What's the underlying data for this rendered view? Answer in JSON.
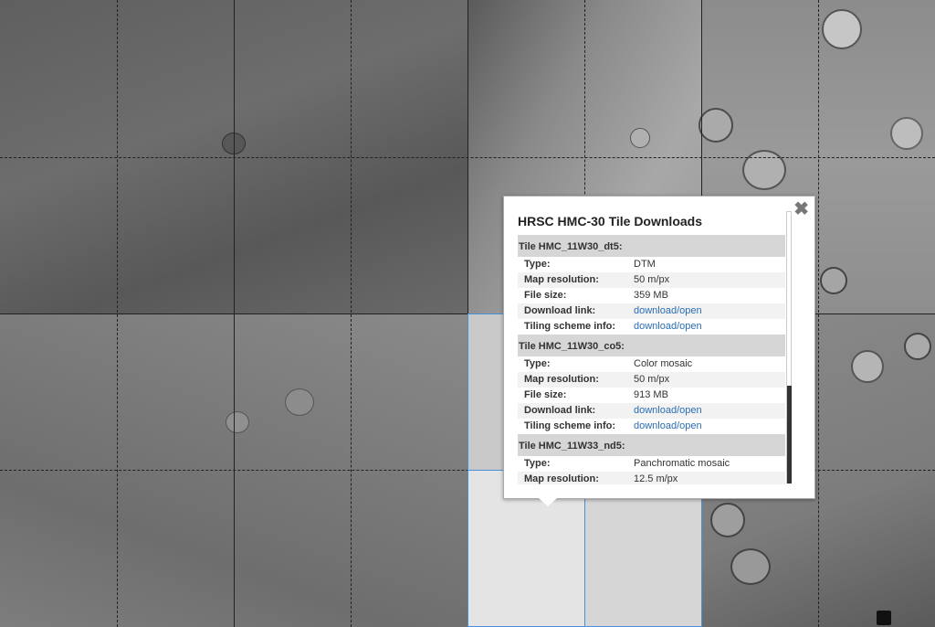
{
  "popup": {
    "title": "HRSC HMC-30 Tile Downloads",
    "close_icon": "close-icon",
    "tiles": [
      {
        "heading": "Tile HMC_11W30_dt5:",
        "rows": [
          {
            "label": "Type:",
            "value": "DTM",
            "link": false
          },
          {
            "label": "Map resolution:",
            "value": "50 m/px",
            "link": false
          },
          {
            "label": "File size:",
            "value": "359 MB",
            "link": false
          },
          {
            "label": "Download link:",
            "value": "download/open",
            "link": true
          },
          {
            "label": "Tiling scheme info:",
            "value": "download/open",
            "link": true
          }
        ]
      },
      {
        "heading": "Tile HMC_11W30_co5:",
        "rows": [
          {
            "label": "Type:",
            "value": "Color mosaic",
            "link": false
          },
          {
            "label": "Map resolution:",
            "value": "50 m/px",
            "link": false
          },
          {
            "label": "File size:",
            "value": "913 MB",
            "link": false
          },
          {
            "label": "Download link:",
            "value": "download/open",
            "link": true
          },
          {
            "label": "Tiling scheme info:",
            "value": "download/open",
            "link": true
          }
        ]
      },
      {
        "heading": "Tile HMC_11W33_nd5:",
        "rows": [
          {
            "label": "Type:",
            "value": "Panchromatic mosaic",
            "link": false
          },
          {
            "label": "Map resolution:",
            "value": "12.5 m/px",
            "link": false
          }
        ]
      }
    ]
  },
  "colors": {
    "link": "#2a6db5",
    "highlight": "#4a90d9",
    "section_bg": "#d6d6d6"
  }
}
